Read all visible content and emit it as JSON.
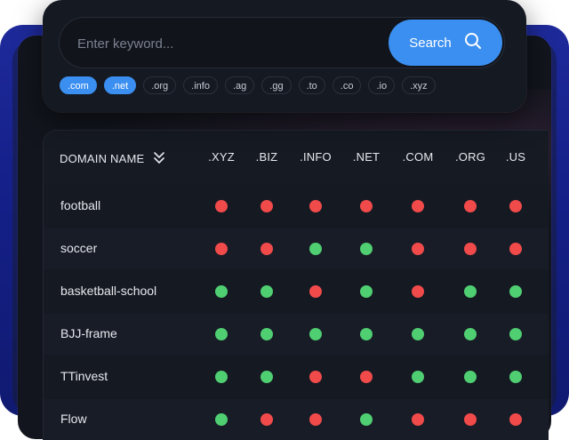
{
  "search": {
    "placeholder": "Enter keyword...",
    "button_label": "Search",
    "icon": "search-icon"
  },
  "tlds": [
    {
      "label": ".com",
      "active": true
    },
    {
      "label": ".net",
      "active": true
    },
    {
      "label": ".org",
      "active": false
    },
    {
      "label": ".info",
      "active": false
    },
    {
      "label": ".ag",
      "active": false
    },
    {
      "label": ".gg",
      "active": false
    },
    {
      "label": ".to",
      "active": false
    },
    {
      "label": ".co",
      "active": false
    },
    {
      "label": ".io",
      "active": false
    },
    {
      "label": ".xyz",
      "active": false
    }
  ],
  "table": {
    "first_header": "DOMAIN NAME",
    "sort_icon": "double-chevron-down-icon",
    "columns": [
      ".XYZ",
      ".BIZ",
      ".INFO",
      ".NET",
      ".COM",
      ".ORG",
      ".US"
    ],
    "rows": [
      {
        "name": "football",
        "availability": [
          false,
          false,
          false,
          false,
          false,
          false,
          false
        ]
      },
      {
        "name": "soccer",
        "availability": [
          false,
          false,
          true,
          true,
          false,
          false,
          false
        ]
      },
      {
        "name": "basketball-school",
        "availability": [
          true,
          true,
          false,
          true,
          false,
          true,
          true
        ]
      },
      {
        "name": "BJJ-frame",
        "availability": [
          true,
          true,
          true,
          true,
          true,
          true,
          true
        ]
      },
      {
        "name": "TTinvest",
        "availability": [
          true,
          true,
          false,
          false,
          true,
          true,
          true
        ]
      },
      {
        "name": "Flow",
        "availability": [
          true,
          false,
          false,
          true,
          false,
          false,
          false
        ]
      }
    ]
  },
  "colors": {
    "accent": "#3b8ff0",
    "available": "#4fce72",
    "unavailable": "#f04a4a",
    "panel": "#151922",
    "backdrop": "#1e2a9a"
  }
}
